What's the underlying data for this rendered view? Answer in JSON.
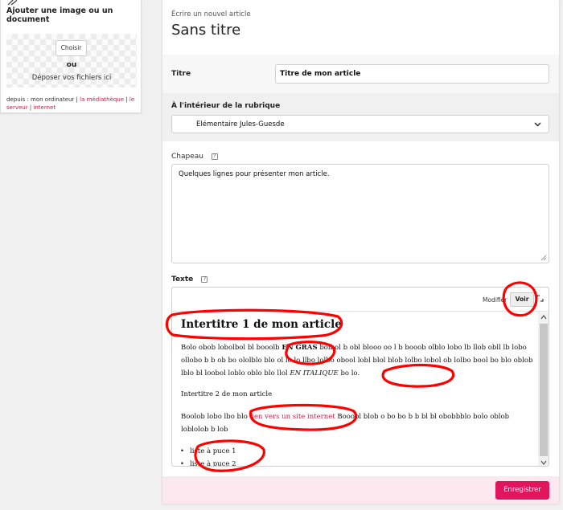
{
  "upload": {
    "title": "Ajouter une image ou un document",
    "choose_button": "Choisir",
    "or_text": "ou",
    "drop_text": "Déposer vos fichiers ici",
    "sources_prefix": "depuis : mon ordinateur |",
    "source_mediatheque": "la médiathèque",
    "source_server": "le serveur",
    "source_internet": "internet"
  },
  "header": {
    "kicker": "Écrire un nouvel article",
    "title": "Sans titre"
  },
  "form": {
    "titre_label": "Titre",
    "titre_value": "Titre de mon article",
    "rubrique_label": "À l'intérieur de la rubrique",
    "rubrique_value": "Elémentaire Jules-Guesde",
    "chapeau_label": "Chapeau",
    "chapeau_value": "Quelques lignes pour présenter mon article.",
    "texte_label": "Texte",
    "help_glyph": "?"
  },
  "editor": {
    "modify_label": "Modifier",
    "view_button": "Voir",
    "preview": {
      "h1": "Intertitre 1 de mon article",
      "p1_a": "Bolo obob lobolbol bl booolb",
      "p1_bold": "EN GRAS",
      "p1_b": "bolbol b obl blooo oo l b booob olblo lobo lb llob obll lb lobo ollobo b b ob bo ololblo blo ol lo lo llbo lolbo obool lobl blol blob lolbo lobol ob lolbo bool bo blo oblob lblo bl loobol loblo oblo blo llol",
      "p1_italic": "EN ITALIQUE",
      "p1_c": "bo lo.",
      "h2": "Intertitre 2 de mon article",
      "p2_a": "Boolob lobo lbo blo",
      "p2_link": "lien vers un site internet",
      "p2_b": "Booobl blob o bo bo b b bl bl obobbblo bolo oblob loblolob b lob",
      "list_item_1": "liste à puce 1",
      "list_item_2": "liste à puce 2"
    }
  },
  "footer": {
    "save_button": "Enregistrer"
  },
  "colors": {
    "accent": "#e0155b",
    "link": "#c8204a",
    "footer_bg": "#fce8ef",
    "annotation": "#ff0000"
  },
  "icons": [
    "paperclip-icon",
    "chevron-down-icon",
    "help-icon",
    "resize-grip-icon",
    "expand-icon",
    "scroll-up-icon",
    "scroll-down-icon"
  ]
}
